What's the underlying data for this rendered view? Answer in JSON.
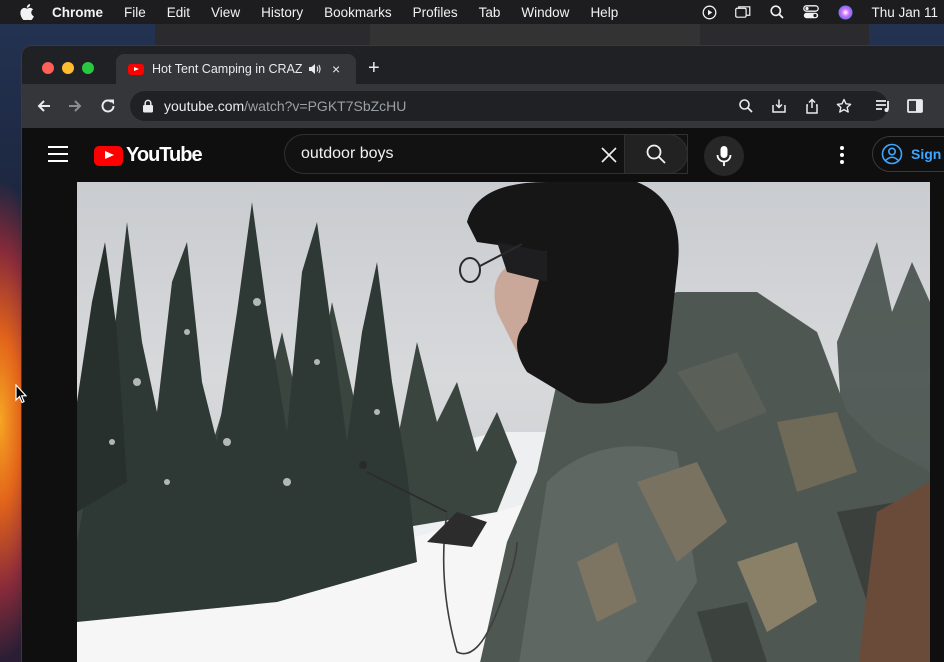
{
  "menubar": {
    "app": "Chrome",
    "items": [
      "File",
      "Edit",
      "View",
      "History",
      "Bookmarks",
      "Profiles",
      "Tab",
      "Window",
      "Help"
    ],
    "clock": "Thu Jan 11"
  },
  "tab": {
    "title": "Hot Tent Camping in CRAZ",
    "close": "×",
    "new_tab": "+"
  },
  "omnibox": {
    "domain": "youtube.com",
    "path": "/watch?v=PGKT7SbZcHU"
  },
  "youtube": {
    "logo_text": "YouTube",
    "search_value": "outdoor boys",
    "sign_in": "Sign i"
  },
  "colors": {
    "youtube_red": "#ff0000",
    "link_blue": "#3ea6ff",
    "page_bg": "#0f0f0f"
  }
}
